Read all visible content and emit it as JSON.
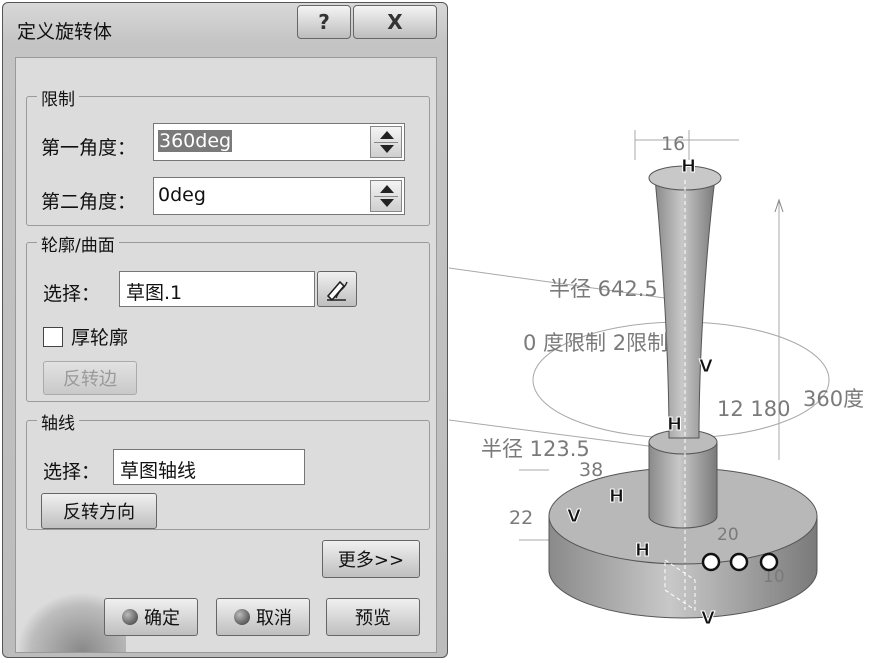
{
  "dialog": {
    "title": "定义旋转体",
    "help_label": "?",
    "close_label": "X"
  },
  "limits": {
    "group_title": "限制",
    "first_angle_label": "第一角度：",
    "first_angle_value": "360deg",
    "second_angle_label": "第二角度：",
    "second_angle_value": "0deg"
  },
  "profile": {
    "group_title": "轮廓/曲面",
    "select_label": "选择：",
    "select_value": "草图.1",
    "thick_profile_label": "厚轮廓",
    "thick_profile_checked": false,
    "reverse_side_label": "反转边"
  },
  "axis": {
    "group_title": "轴线",
    "select_label": "选择：",
    "select_value": "草图轴线",
    "reverse_direction_label": "反转方向"
  },
  "buttons": {
    "more_label": "更多>>",
    "ok_label": "确定",
    "cancel_label": "取消",
    "preview_label": "预览"
  },
  "viewport": {
    "dim_top": "16",
    "radius_outer": "半径 642.5",
    "limits_text": "0 度限制 2限制",
    "angle_text": "12 180",
    "angle_360": "360度",
    "radius_inner": "半径 123.5",
    "dim_38": "38",
    "dim_22": "22",
    "dim_20": "20",
    "dim_10": "10",
    "handle_h": "H",
    "handle_v": "V"
  }
}
